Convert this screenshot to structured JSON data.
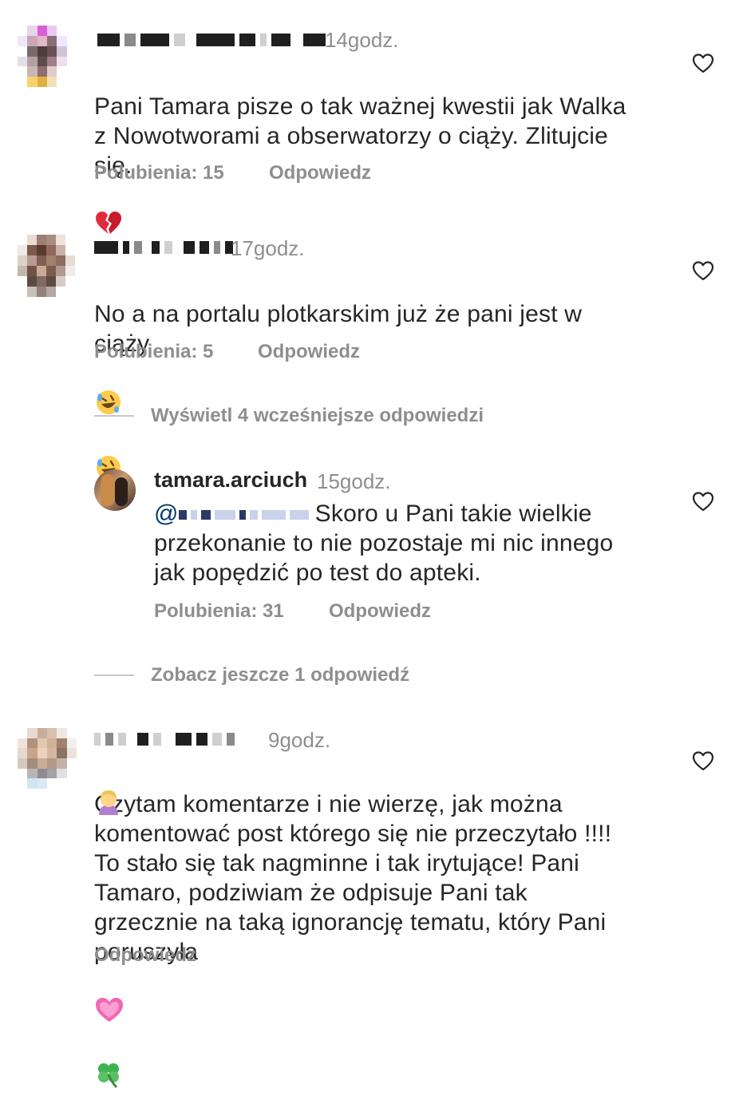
{
  "comments": [
    {
      "time": "14godz.",
      "text": "Pani Tamara pisze o tak ważnej kwestii jak Walka\nz Nowotworami a obserwatorzy o ciąży. Zlitujcie\nsię.",
      "likes": "Polubienia: 15",
      "reply": "Odpowiedz",
      "emoji_icons": [
        "broken-heart-icon"
      ]
    },
    {
      "time": "17godz.",
      "text": "No a na portalu plotkarskim już że pani jest w\nciąży",
      "likes": "Polubienia: 5",
      "reply": "Odpowiedz",
      "emoji_icons": [
        "rofl-emoji-icon",
        "rofl-emoji-icon"
      ]
    },
    {
      "time": "9godz.",
      "text": "Czytam komentarze i nie wierzę, jak można\nkomentować post którego się nie przeczytało !!!!\nTo stało się tak nagminne i tak irytujące! Pani\nTamaro, podziwiam że odpisuje Pani tak\ngrzecznie na taką ignorancję tematu, który Pani\nporuszyła",
      "reply": "Odpowiedz",
      "emoji_icons": [
        "woman-facepalm-icon",
        "pink-heart-icon",
        "clover-icon"
      ]
    }
  ],
  "view_previous": "Wyświetl 4 wcześniejsze odpowiedzi",
  "reply_comment": {
    "username": "tamara.arciuch",
    "time": "15godz.",
    "text_line1": "Skoro u Pani takie wielkie",
    "text_rest": "przekonanie to nie pozostaje mi nic innego\njak popędzić po test do apteki.",
    "mention_prefix": "@",
    "likes": "Polubienia: 31",
    "reply": "Odpowiedz"
  },
  "see_more": "Zobacz jeszcze 1 odpowiedź",
  "colors": {
    "text": "#262626",
    "secondary": "#8e8e8e",
    "divider": "#c7c7c7",
    "background": "#ffffff"
  },
  "icons": [
    "heart-outline-icon"
  ]
}
